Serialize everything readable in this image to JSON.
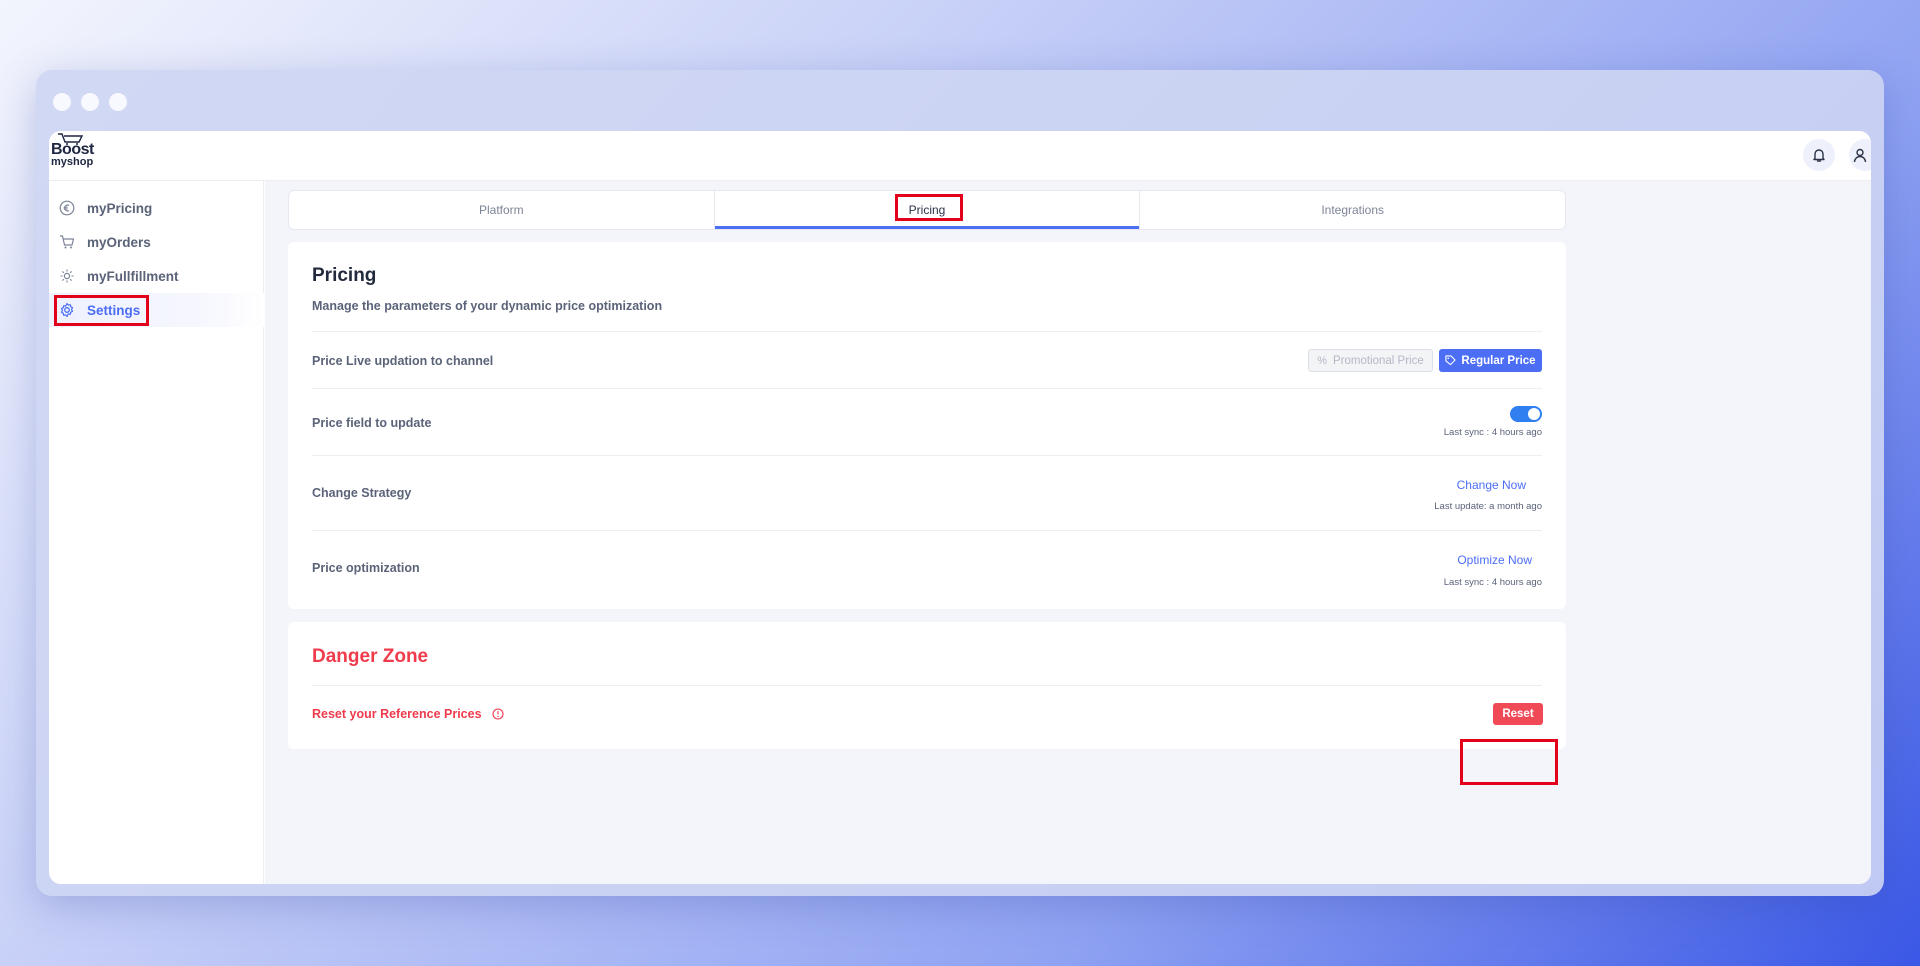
{
  "app": {
    "logo_top": "Boost",
    "logo_bottom": "myshop"
  },
  "sidebar": {
    "items": [
      {
        "label": "myPricing",
        "icon": "euro-icon",
        "active": false
      },
      {
        "label": "myOrders",
        "icon": "cart-icon",
        "active": false
      },
      {
        "label": "myFullfillment",
        "icon": "sun-icon",
        "active": false
      },
      {
        "label": "Settings",
        "icon": "gear-icon",
        "active": true
      }
    ]
  },
  "tabs": [
    {
      "label": "Platform",
      "active": false
    },
    {
      "label": "Pricing",
      "active": true
    },
    {
      "label": "Integrations",
      "active": false
    }
  ],
  "pricing": {
    "title": "Pricing",
    "subtitle": "Manage the parameters of your dynamic price optimization",
    "rows": {
      "live_update": {
        "label": "Price Live updation to channel",
        "promo_label": "Promotional Price",
        "regular_label": "Regular Price"
      },
      "price_field": {
        "label": "Price field to update",
        "meta": "Last sync : 4 hours ago",
        "toggle_on": true
      },
      "strategy": {
        "label": "Change Strategy",
        "action": "Change Now",
        "meta": "Last update: a month ago"
      },
      "optimization": {
        "label": "Price optimization",
        "action": "Optimize Now",
        "meta": "Last sync : 4 hours ago"
      }
    }
  },
  "danger": {
    "title": "Danger Zone",
    "reset_label": "Reset your Reference Prices",
    "reset_button": "Reset"
  },
  "colors": {
    "accent": "#4c6ef5",
    "danger": "#ef3b4c",
    "highlight": "#e3001b"
  }
}
